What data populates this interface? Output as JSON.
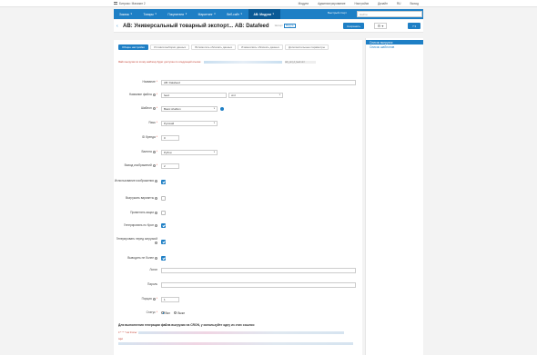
{
  "topbar": {
    "brand": "Битрикс: Магазин 2",
    "items": [
      "Модули",
      "Администрирование",
      "Настройки",
      "Дизайн",
      "RU",
      "Выход"
    ]
  },
  "nav": {
    "items": [
      {
        "label": "Заказы"
      },
      {
        "label": "Товары"
      },
      {
        "label": "Покупатели"
      },
      {
        "label": "Маркетинг"
      },
      {
        "label": "Веб-сайт"
      },
      {
        "label": "AB: Модули",
        "active": true
      }
    ],
    "quick_start": "Быстрый старт",
    "search_placeholder": "Найти"
  },
  "header": {
    "title": "AB: Универсальный товарный экспорт... AB: Datafeed",
    "pill_left": "Экспорт",
    "pill_right": "Модуль",
    "save_label": "Сохранить",
    "gear_label": "⚙ ▾",
    "help_label": "? ▾"
  },
  "sidebar": {
    "items": [
      {
        "label": "Список выгрузок",
        "active": true
      },
      {
        "label": "Список шаблонов",
        "active": false
      }
    ]
  },
  "tabs": [
    {
      "label": "Общие настройки",
      "active": true
    },
    {
      "label": "Условия выборки данных",
      "active": false
    },
    {
      "label": "Вспомогать облачать данных",
      "active": false
    },
    {
      "label": "Изменялись облачать данных",
      "active": false
    },
    {
      "label": "Дополнительные параметры",
      "active": false
    }
  ],
  "hint": {
    "text": "Файл выгрузки по этому шаблону будет доступен по следующей ссылке:",
    "link_tail": "/ab_yml_d_feed.xml"
  },
  "form": {
    "name": {
      "label": "Название",
      "value": "AB: Datafeed"
    },
    "filename": {
      "label": "Название файла",
      "value": "feed",
      "ext": "xml"
    },
    "template": {
      "label": "Шаблон",
      "value": "Basic shablon"
    },
    "lang": {
      "label": "Язык",
      "value": "Русский"
    },
    "brand_id": {
      "label": "ID бренда",
      "value": "0"
    },
    "currency": {
      "label": "Валюта",
      "value": "Рубли"
    },
    "images_limit": {
      "label": "Вывод изображений",
      "value": "2"
    },
    "resize_images": {
      "label": "Использование изображения"
    },
    "unload_variants": {
      "label": "Выгружать варианты"
    },
    "apply_discounts": {
      "label": "Применять акции"
    },
    "gen_crontab": {
      "label": "Генерировать по Крон"
    },
    "gen_before": {
      "label": "Генерировать перед загрузкой"
    },
    "show_in_popup": {
      "label": "Выводить не более"
    },
    "login": {
      "label": "Логин",
      "value": ""
    },
    "password": {
      "label": "Пароль",
      "value": ""
    },
    "step": {
      "label": "Порция",
      "value": "1"
    },
    "status": {
      "label": "Статус",
      "on_label": "Вкл",
      "off_label": "Выкл"
    }
  },
  "bottom": {
    "note": "Для выполнения генерации файла выгрузки на CRON, у используйте одну из этих ссылок:",
    "line1_prefix": "0 * * * * /usr /home/",
    "line2_prefix": "wget"
  },
  "colors": {
    "accent": "#1e7fc5",
    "nav_active": "#0b5a96",
    "warn": "#c0392b"
  }
}
